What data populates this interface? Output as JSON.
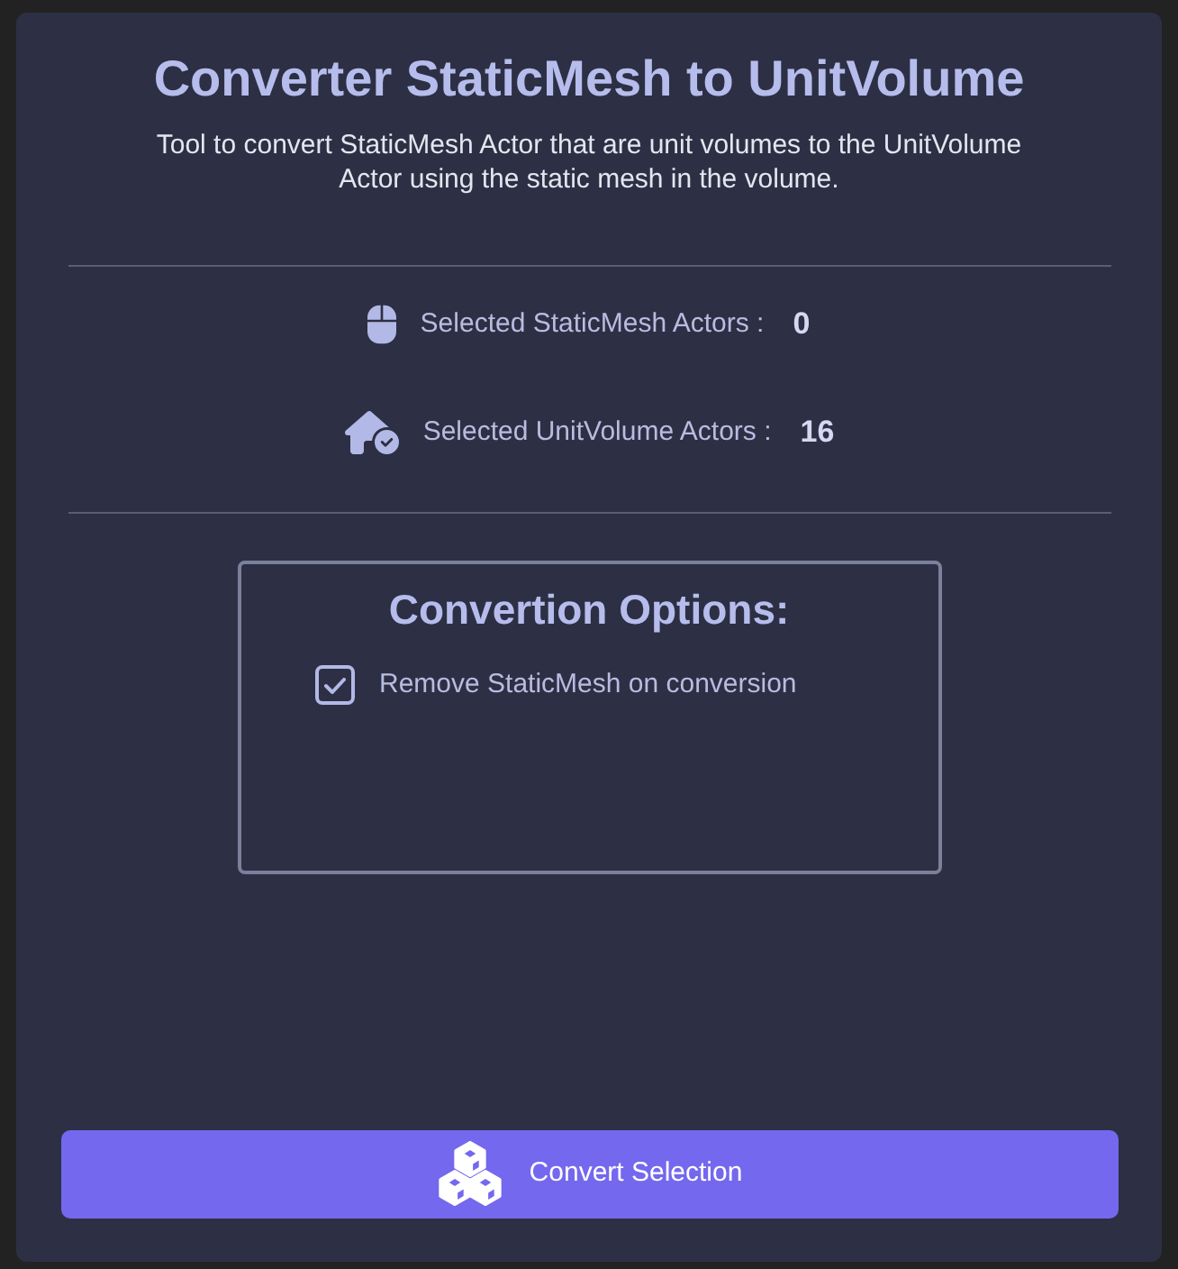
{
  "title": "Converter StaticMesh to UnitVolume",
  "description": "Tool to convert StaticMesh Actor that are unit volumes to the UnitVolume Actor using the static mesh in the volume.",
  "stats": [
    {
      "kind": "mouse",
      "label": "Selected StaticMesh Actors :",
      "value": "0"
    },
    {
      "kind": "house",
      "label": "Selected UnitVolume Actors :",
      "value": "16"
    }
  ],
  "options": {
    "title": "Convertion Options:",
    "items": [
      {
        "label": "Remove StaticMesh on conversion",
        "checked": true
      }
    ]
  },
  "button": {
    "label": "Convert Selection"
  }
}
